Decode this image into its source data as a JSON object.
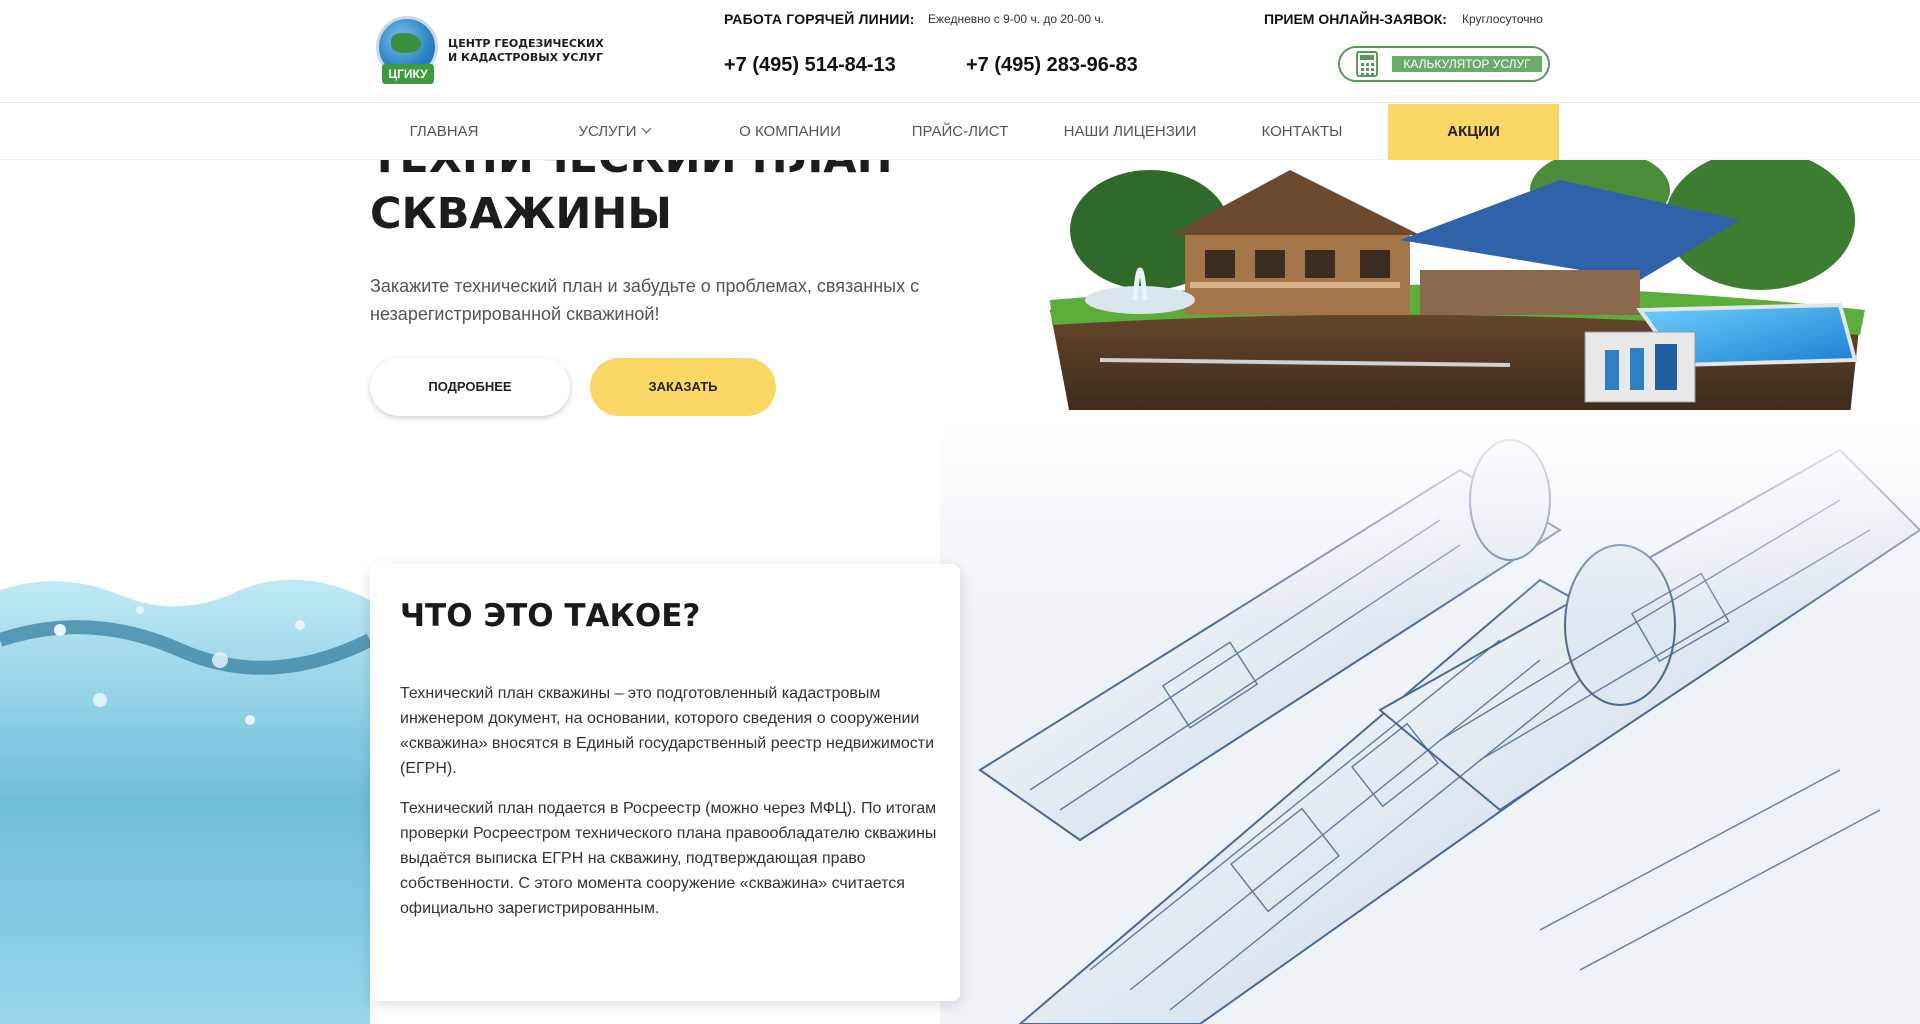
{
  "header": {
    "logo_text_line1": "ЦЕНТР ГЕОДЕЗИЧЕСКИХ",
    "logo_text_line2": "И КАДАСТРОВЫХ УСЛУГ",
    "logo_badge": "ЦГИКУ",
    "hotline_label": "РАБОТА ГОРЯЧЕЙ ЛИНИИ:",
    "hotline_hours": "Ежедневно с 9-00 ч. до 20-00 ч.",
    "phone1": "+7 (495) 514-84-13",
    "phone2": "+7 (495) 283-96-83",
    "online_label": "ПРИЕМ ОНЛАЙН-ЗАЯВОК:",
    "online_hours": "Круглосуточно",
    "calc_button": "КАЛЬКУЛЯТОР УСЛУГ",
    "accent_color": "#5a9a5a"
  },
  "nav": {
    "items": [
      {
        "label": "ГЛАВНАЯ"
      },
      {
        "label": "УСЛУГИ"
      },
      {
        "label": "О КОМПАНИИ"
      },
      {
        "label": "ПРАЙС-ЛИСТ"
      },
      {
        "label": "НАШИ ЛИЦЕНЗИИ"
      },
      {
        "label": "КОНТАКТЫ"
      }
    ],
    "promo": "АКЦИИ",
    "promo_color": "#fbd866"
  },
  "hero": {
    "title_line1": "ТЕХНИЧЕСКИЙ ПЛАН",
    "title_line2": "СКВАЖИНЫ",
    "subtitle": "Закажите технический план и забудьте о проблемах, связанных с незарегистрированной скважиной!",
    "btn_more": "ПОДРОБНЕЕ",
    "btn_order": "ЗАКАЗАТЬ"
  },
  "info": {
    "title": "ЧТО ЭТО ТАКОЕ?",
    "paragraph1": "Технический план скважины – это подготовленный кадастровым инженером документ, на основании, которого сведения о сооружении «скважина» вносятся в Единый государственный реестр недвижимости (ЕГРН).",
    "paragraph2": "Технический план подается в Росреестр (можно через МФЦ). По итогам проверки Росреестром технического плана правообладателю скважины выдаётся выписка ЕГРН на скважину, подтверждающая право собственности. С этого момента сооружение «скважина» считается официально зарегистрированным."
  }
}
